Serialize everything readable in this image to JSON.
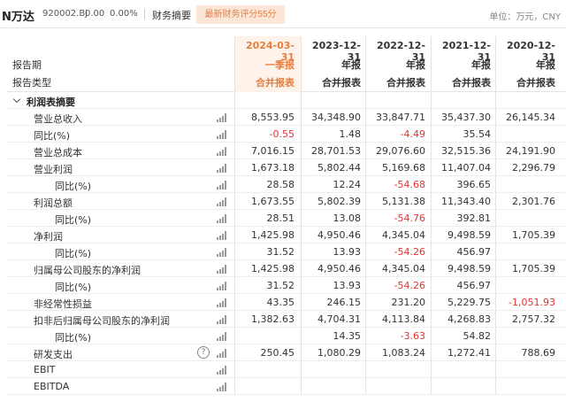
{
  "header": {
    "name": "N万达",
    "code": "920002.BJ",
    "price": "0.00",
    "change": "0.00%",
    "tab": "财务摘要",
    "score_button": "最新财务评分55分",
    "unit": "单位：万元，CNY"
  },
  "table": {
    "head_labels": {
      "period": "报告期",
      "report_type": "报告类型"
    },
    "columns": [
      {
        "date": "2024-03-31",
        "ptype": "一季报",
        "rtype": "合并报表"
      },
      {
        "date": "2023-12-31",
        "ptype": "年报",
        "rtype": "合并报表"
      },
      {
        "date": "2022-12-31",
        "ptype": "年报",
        "rtype": "合并报表"
      },
      {
        "date": "2021-12-31",
        "ptype": "年报",
        "rtype": "合并报表"
      },
      {
        "date": "2020-12-31",
        "ptype": "年报",
        "rtype": "合并报表"
      }
    ],
    "section_title": "利润表摘要",
    "rows": [
      {
        "label": "营业总收入",
        "values": [
          "8,553.95",
          "34,348.90",
          "33,847.71",
          "35,437.30",
          "26,145.34"
        ]
      },
      {
        "label": "同比(%)",
        "values": [
          "-0.55",
          "1.48",
          "-4.49",
          "35.54",
          ""
        ]
      },
      {
        "label": "营业总成本",
        "values": [
          "7,016.15",
          "28,701.53",
          "29,076.60",
          "32,515.36",
          "24,191.90"
        ]
      },
      {
        "label": "营业利润",
        "values": [
          "1,673.18",
          "5,802.44",
          "5,169.68",
          "11,407.04",
          "2,296.79"
        ]
      },
      {
        "label": "同比(%)",
        "values": [
          "28.58",
          "12.24",
          "-54.68",
          "396.65",
          ""
        ]
      },
      {
        "label": "利润总额",
        "values": [
          "1,673.55",
          "5,802.39",
          "5,131.38",
          "11,343.40",
          "2,301.76"
        ]
      },
      {
        "label": "同比(%)",
        "values": [
          "28.51",
          "13.08",
          "-54.76",
          "392.81",
          ""
        ]
      },
      {
        "label": "净利润",
        "values": [
          "1,425.98",
          "4,950.46",
          "4,345.04",
          "9,498.59",
          "1,705.39"
        ]
      },
      {
        "label": "同比(%)",
        "values": [
          "31.52",
          "13.93",
          "-54.26",
          "456.97",
          ""
        ]
      },
      {
        "label": "归属母公司股东的净利润",
        "values": [
          "1,425.98",
          "4,950.46",
          "4,345.04",
          "9,498.59",
          "1,705.39"
        ]
      },
      {
        "label": "同比(%)",
        "values": [
          "31.52",
          "13.93",
          "-54.26",
          "456.97",
          ""
        ]
      },
      {
        "label": "非经常性损益",
        "values": [
          "43.35",
          "246.15",
          "231.20",
          "5,229.75",
          "-1,051.93"
        ]
      },
      {
        "label": "扣非后归属母公司股东的净利润",
        "values": [
          "1,382.63",
          "4,704.31",
          "4,113.84",
          "4,268.83",
          "2,757.32"
        ]
      },
      {
        "label": "同比(%)",
        "values": [
          "",
          "14.35",
          "-3.63",
          "54.82",
          ""
        ]
      },
      {
        "label": "研发支出",
        "values": [
          "250.45",
          "1,080.29",
          "1,083.24",
          "1,272.41",
          "788.69"
        ],
        "help": "?"
      },
      {
        "label": "EBIT",
        "values": [
          "",
          "",
          "",
          "",
          ""
        ]
      },
      {
        "label": "EBITDA",
        "values": [
          "",
          "",
          "",
          "",
          ""
        ]
      }
    ]
  },
  "icons": {
    "trend": "bar-chart-icon",
    "help": "question-circle-icon",
    "section": "chevron-down-icon"
  },
  "colors": {
    "accent": "#e87d3e",
    "negative": "#e8312f",
    "score_bg": "#fbe6d8"
  }
}
